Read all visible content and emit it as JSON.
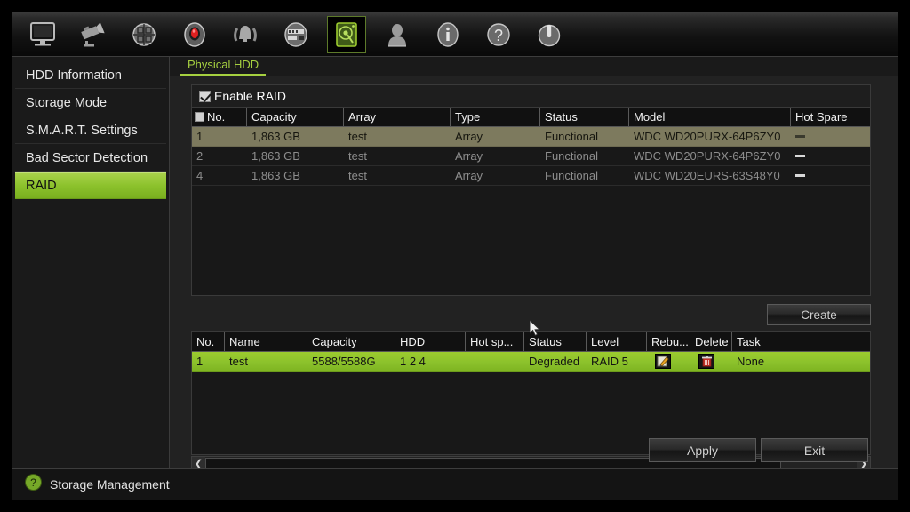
{
  "toolbar": {
    "icons": [
      {
        "name": "monitor-icon",
        "label": "Live View"
      },
      {
        "name": "camera-icon",
        "label": "Camera"
      },
      {
        "name": "network-icon",
        "label": "Network"
      },
      {
        "name": "record-icon",
        "label": "Record"
      },
      {
        "name": "alarm-bell-icon",
        "label": "Alarm"
      },
      {
        "name": "device-icon",
        "label": "Device"
      },
      {
        "name": "hdd-icon",
        "label": "Storage Management"
      },
      {
        "name": "user-icon",
        "label": "User"
      },
      {
        "name": "info-icon",
        "label": "System Information"
      },
      {
        "name": "help-icon",
        "label": "Help"
      },
      {
        "name": "power-icon",
        "label": "Shutdown"
      }
    ],
    "active_index": 6
  },
  "sidebar": {
    "items": [
      {
        "label": "HDD Information",
        "selected": false
      },
      {
        "label": "Storage Mode",
        "selected": false
      },
      {
        "label": "S.M.A.R.T. Settings",
        "selected": false
      },
      {
        "label": "Bad Sector Detection",
        "selected": false
      },
      {
        "label": "RAID",
        "selected": true
      }
    ]
  },
  "tabs": [
    {
      "label": "Physical HDD",
      "active": true
    }
  ],
  "enable_raid": {
    "label": "Enable RAID",
    "checked": true
  },
  "physical_hdd_table": {
    "columns": [
      "No.",
      "Capacity",
      "Array",
      "Type",
      "Status",
      "Model",
      "Hot Spare"
    ],
    "rows": [
      {
        "no": "1",
        "capacity": "1,863 GB",
        "array": "test",
        "type": "Array",
        "status": "Functional",
        "model": "WDC WD20PURX-64P6ZY0",
        "hot_spare": "-",
        "selected": true
      },
      {
        "no": "2",
        "capacity": "1,863 GB",
        "array": "test",
        "type": "Array",
        "status": "Functional",
        "model": "WDC WD20PURX-64P6ZY0",
        "hot_spare": "-",
        "selected": false
      },
      {
        "no": "4",
        "capacity": "1,863 GB",
        "array": "test",
        "type": "Array",
        "status": "Functional",
        "model": "WDC WD20EURS-63S48Y0",
        "hot_spare": "-",
        "selected": false
      }
    ]
  },
  "create_button": {
    "label": "Create"
  },
  "array_table": {
    "columns": [
      "No.",
      "Name",
      "Capacity",
      "HDD",
      "Hot sp...",
      "Status",
      "Level",
      "Rebu...",
      "Delete",
      "Task"
    ],
    "rows": [
      {
        "no": "1",
        "name": "test",
        "capacity": "5588/5588G",
        "hdd": "1 2 4",
        "hot_spare": "",
        "status": "Degraded",
        "level": "RAID 5",
        "rebuild_icon": "edit-pencil-icon",
        "delete_icon": "trash-icon",
        "task": "None",
        "selected": true
      }
    ]
  },
  "scrollbar": {
    "left_arrow": "❮",
    "right_arrow": "❯"
  },
  "footer_buttons": {
    "apply": "Apply",
    "exit": "Exit"
  },
  "statusbar": {
    "icon": "help-circle-icon",
    "text": "Storage Management"
  },
  "colors": {
    "accent_green": "#8cc22c",
    "tab_green": "#a6d040",
    "selected_row_khaki": "#7d7a5e",
    "delete_red": "#c03228"
  }
}
